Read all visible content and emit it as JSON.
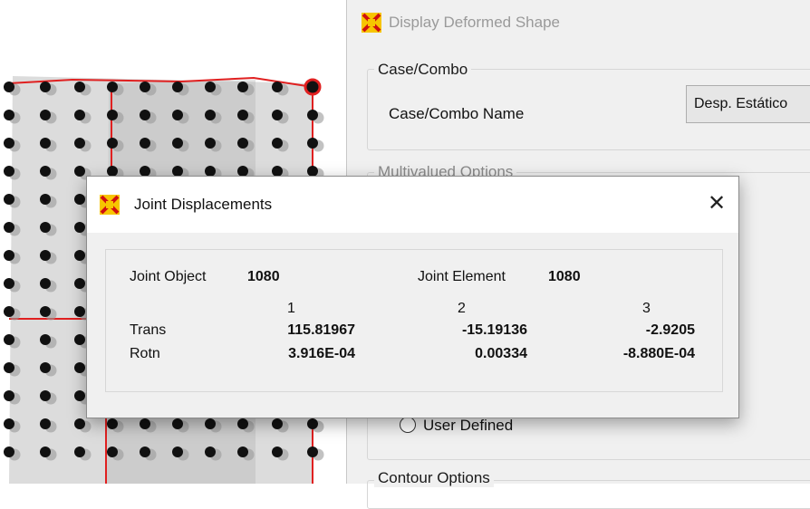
{
  "colors": {
    "grid_red": "#e02020",
    "joint_fill": "#111111",
    "shade": "#c0c0c0"
  },
  "deform_dialog": {
    "title": "Display Deformed Shape",
    "icon": "sap-logo-icon",
    "case_combo": {
      "group_label": "Case/Combo",
      "name_label": "Case/Combo Name",
      "name_value": "Desp. Estático"
    },
    "multivalued_label": "Multivalued Options",
    "user_defined_label": "User Defined",
    "contour_label": "Contour Options"
  },
  "joint_dialog": {
    "title": "Joint Displacements",
    "icon": "sap-logo-icon",
    "close_glyph": "✕",
    "joint_object_label": "Joint  Object",
    "joint_object_value": "1080",
    "joint_element_label": "Joint Element",
    "joint_element_value": "1080",
    "columns": [
      "1",
      "2",
      "3"
    ],
    "rows": [
      {
        "label": "Trans",
        "values": [
          "115.81967",
          "-15.19136",
          "-2.9205"
        ]
      },
      {
        "label": "Rotn",
        "values": [
          "3.916E-04",
          "0.00334",
          "-8.880E-04"
        ]
      }
    ]
  }
}
